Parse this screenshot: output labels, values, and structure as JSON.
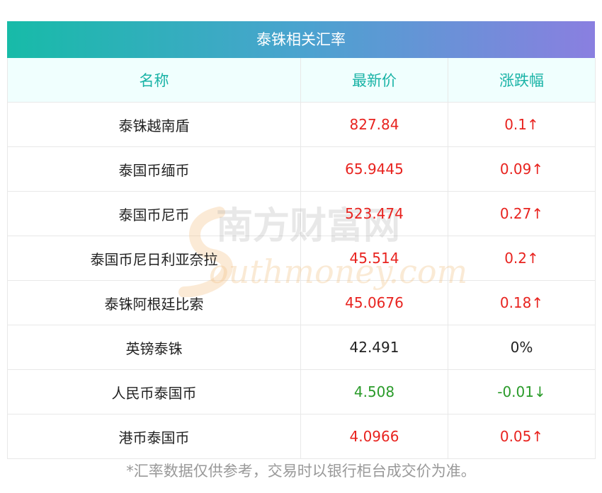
{
  "title": "泰铢相关汇率",
  "headers": [
    "名称",
    "最新价",
    "涨跌幅"
  ],
  "rows": [
    {
      "name": "泰铢越南盾",
      "price": "827.84",
      "change": "0.1↑",
      "trend": "up"
    },
    {
      "name": "泰国币缅币",
      "price": "65.9445",
      "change": "0.09↑",
      "trend": "up"
    },
    {
      "name": "泰国币尼币",
      "price": "523.474",
      "change": "0.27↑",
      "trend": "up"
    },
    {
      "name": "泰国币尼日利亚奈拉",
      "price": "45.514",
      "change": "0.2↑",
      "trend": "up"
    },
    {
      "name": "泰铢阿根廷比索",
      "price": "45.0676",
      "change": "0.18↑",
      "trend": "up"
    },
    {
      "name": "英镑泰铢",
      "price": "42.491",
      "change": "0%",
      "trend": "flat"
    },
    {
      "name": "人民币泰国币",
      "price": "4.508",
      "change": "-0.01↓",
      "trend": "down"
    },
    {
      "name": "港币泰国币",
      "price": "4.0966",
      "change": "0.05↑",
      "trend": "up"
    }
  ],
  "footer": "*汇率数据仅供参考，交易时以银行柜台成交价为准。",
  "watermark": {
    "cn": "南方财富网",
    "en": "outhmoney.com"
  },
  "colors": {
    "up": "#e8231f",
    "down": "#2a9b2a",
    "header_text": "#19b3a6"
  }
}
